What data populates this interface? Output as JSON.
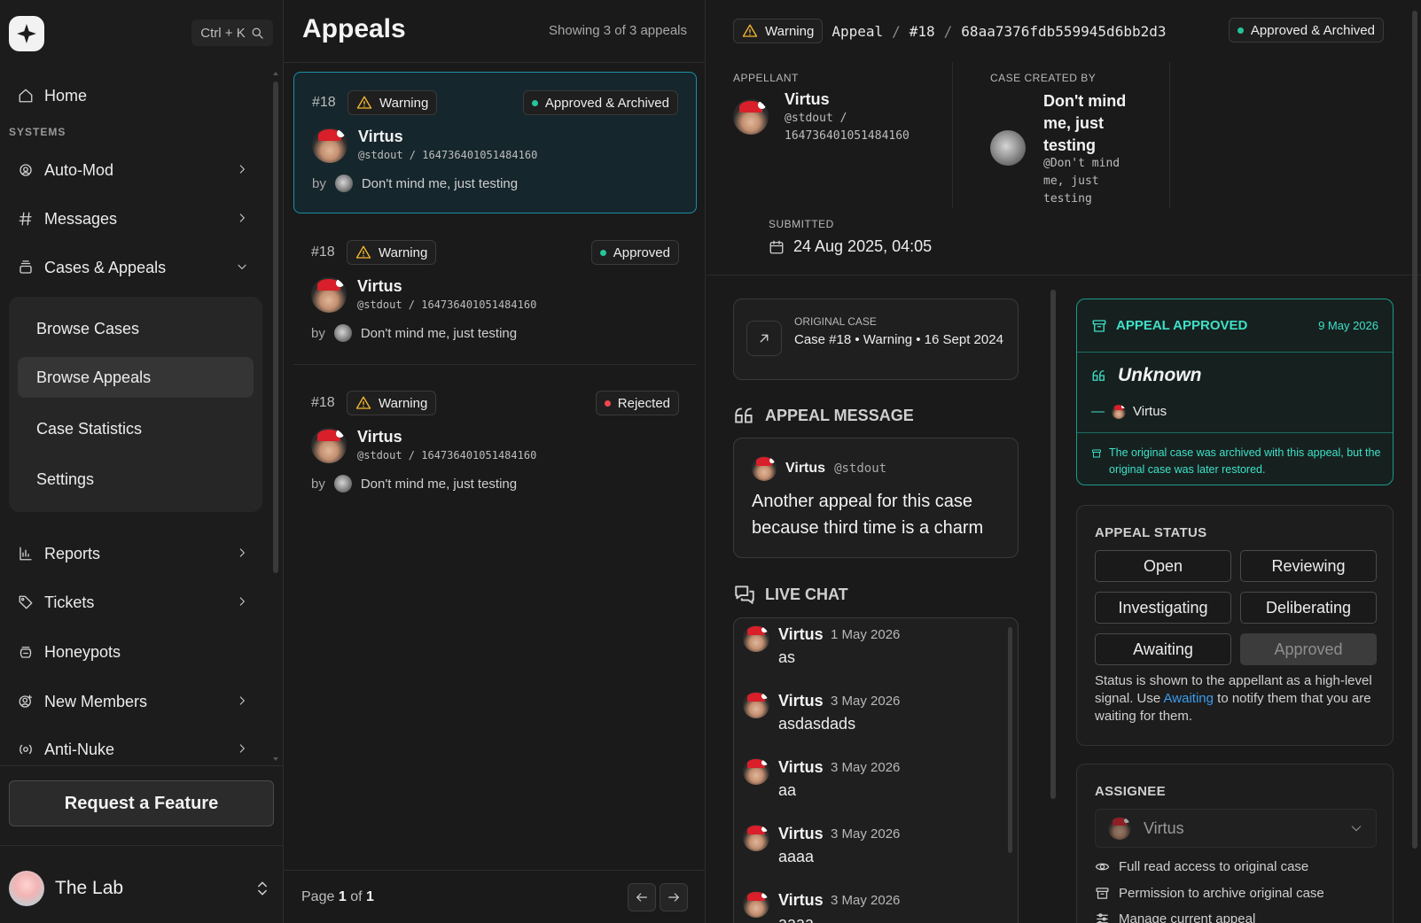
{
  "sidebar": {
    "search_shortcut": "Ctrl + K",
    "home": "Home",
    "section_systems": "SYSTEMS",
    "items": {
      "automod": "Auto-Mod",
      "messages": "Messages",
      "cases": "Cases & Appeals",
      "reports": "Reports",
      "tickets": "Tickets",
      "honeypots": "Honeypots",
      "new_members": "New Members",
      "antinuke": "Anti-Nuke"
    },
    "sub_items": {
      "browse_cases": "Browse Cases",
      "browse_appeals": "Browse Appeals",
      "case_statistics": "Case Statistics",
      "settings": "Settings"
    },
    "request_feature": "Request a Feature",
    "server_name": "The Lab"
  },
  "list": {
    "title": "Appeals",
    "count": "Showing 3 of 3 appeals",
    "by_label": "by",
    "cards": [
      {
        "num": "#18",
        "type": "Warning",
        "status": "Approved & Archived",
        "name": "Virtus",
        "handle": "@stdout / 164736401051484160",
        "by": "Don't mind me, just testing"
      },
      {
        "num": "#18",
        "type": "Warning",
        "status": "Approved",
        "name": "Virtus",
        "handle": "@stdout / 164736401051484160",
        "by": "Don't mind me, just testing"
      },
      {
        "num": "#18",
        "type": "Warning",
        "status": "Rejected",
        "name": "Virtus",
        "handle": "@stdout / 164736401051484160",
        "by": "Don't mind me, just testing"
      }
    ],
    "page_prefix": "Page",
    "page_current": "1",
    "page_of": "of",
    "page_total": "1"
  },
  "detail": {
    "type_badge": "Warning",
    "crumb_appeal": "Appeal",
    "crumb_sep": "/",
    "crumb_case": "#18",
    "crumb_id": "68aa7376fdb559945d6bb2d3",
    "status_badge": "Approved & Archived",
    "appellant_label": "APPELLANT",
    "appellant_name": "Virtus",
    "appellant_handle_1": "@stdout /",
    "appellant_handle_2": "164736401051484160",
    "creator_label": "CASE CREATED BY",
    "creator_name_1": "Don't mind",
    "creator_name_2": "me, just",
    "creator_name_3": "testing",
    "creator_handle_1": "@Don't mind",
    "creator_handle_2": "me, just",
    "creator_handle_3": "testing",
    "submitted_label": "SUBMITTED",
    "submitted_value": "24 Aug 2025, 04:05",
    "original_case_label": "ORIGINAL CASE",
    "original_case_text": "Case #18 • Warning • 16 Sept 2024",
    "appeal_message_head": "APPEAL MESSAGE",
    "message_author": "Virtus",
    "message_handle": "@stdout",
    "message_text": "Another appeal for this case because third time is a charm",
    "live_chat_head": "LIVE CHAT",
    "chat": [
      {
        "name": "Virtus",
        "date": "1 May 2026",
        "text": "as"
      },
      {
        "name": "Virtus",
        "date": "3 May 2026",
        "text": "asdasdads"
      },
      {
        "name": "Virtus",
        "date": "3 May 2026",
        "text": "aa"
      },
      {
        "name": "Virtus",
        "date": "3 May 2026",
        "text": "aaaa"
      },
      {
        "name": "Virtus",
        "date": "3 May 2026",
        "text": "aaaa"
      }
    ],
    "approved_title": "APPEAL APPROVED",
    "approved_date": "9 May 2026",
    "approved_quote": "Unknown",
    "approved_by": "Virtus",
    "approved_note": "The original case was archived with this appeal, but the original case was later restored.",
    "status_label": "APPEAL STATUS",
    "status_options": [
      "Open",
      "Reviewing",
      "Investigating",
      "Deliberating",
      "Awaiting",
      "Approved"
    ],
    "status_selected": "Approved",
    "status_help_1": "Status is shown to the appellant as a high-level signal. Use ",
    "status_help_link": "Awaiting",
    "status_help_2": " to notify them that you are waiting for them.",
    "assignee_label": "ASSIGNEE",
    "assignee_value": "Virtus",
    "permissions": [
      "Full read access to original case",
      "Permission to archive original case",
      "Manage current appeal"
    ]
  },
  "colors": {
    "accent_teal": "#3ee0c8",
    "selected_border": "#1b8fa8",
    "dot_green": "#25c49b",
    "dot_red": "#f0474f",
    "warning_yellow": "#f5b82e",
    "link_blue": "#3a9df0"
  }
}
